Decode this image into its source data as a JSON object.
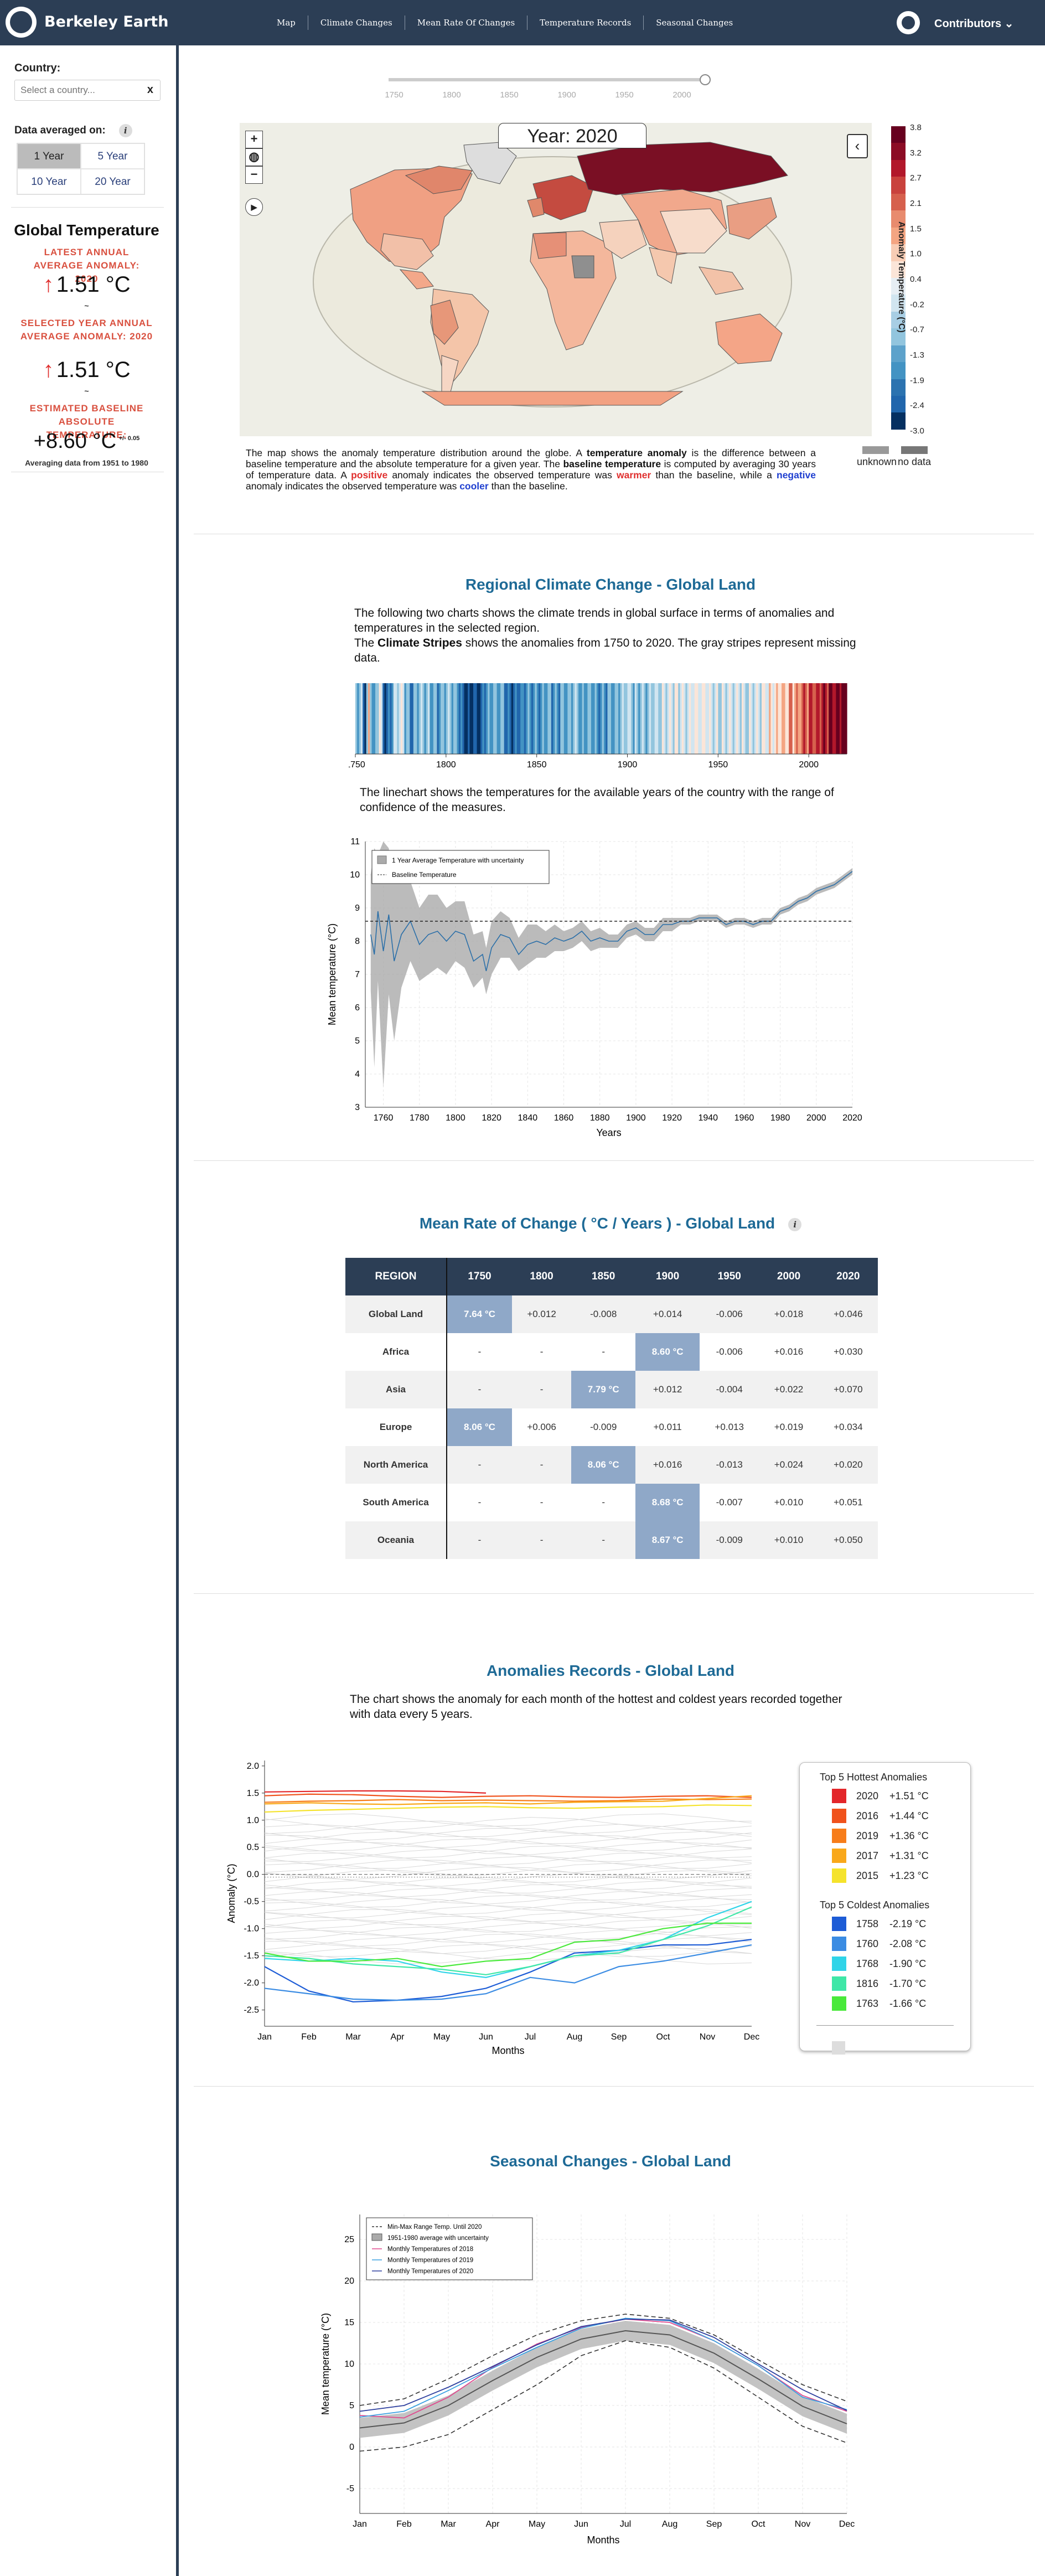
{
  "header": {
    "brand": "Berkeley Earth",
    "nav": [
      "Map",
      "Climate Changes",
      "Mean Rate Of Changes",
      "Temperature Records",
      "Seasonal Changes"
    ],
    "contributors": "Contributors"
  },
  "sidebar": {
    "country_label": "Country:",
    "country_placeholder": "Select a country...",
    "clear": "x",
    "avg_label": "Data averaged on:",
    "avg_options": [
      "1 Year",
      "5 Year",
      "10 Year",
      "20 Year"
    ],
    "avg_selected": "1 Year",
    "global_title": "Global Temperature",
    "latest_label": "LATEST ANNUAL AVERAGE ANOMALY: 2020",
    "latest_value": "1.51 °C",
    "selected_label": "SELECTED YEAR ANNUAL AVERAGE ANOMALY: 2020",
    "selected_value": "1.51 °C",
    "dash": "~",
    "baseline_label": "ESTIMATED BASELINE ABSOLUTE TEMPERATURE:",
    "baseline_value": "+8.60 °C",
    "baseline_unc": "+/- 0.05",
    "baseline_note": "Averaging data from 1951 to 1980"
  },
  "map": {
    "slider_years": [
      "1750",
      "1800",
      "1850",
      "1900",
      "1950",
      "2000"
    ],
    "year_title": "Year: 2020",
    "legend_ticks": [
      "3.8",
      "3.2",
      "2.7",
      "2.1",
      "1.5",
      "1.0",
      "0.4",
      "-0.2",
      "-0.7",
      "-1.3",
      "-1.9",
      "-2.4",
      "-3.0"
    ],
    "legend_title": "Anomaly Temperature (°C)",
    "legend_colors": [
      "#67001f",
      "#8c0c25",
      "#b2182b",
      "#c9423d",
      "#d6604d",
      "#e88b6e",
      "#f4a582",
      "#f8cdb5",
      "#fbe5d8",
      "#e7eef4",
      "#d1e5f0",
      "#a8cee4",
      "#92c5de",
      "#5da2cb",
      "#4393c3",
      "#2c73b0",
      "#2166ac",
      "#053061"
    ],
    "unknown": "unknown",
    "nodata": "no data",
    "desc_html": "The map shows the anomaly temperature distribution around the globe. A <b>temperature anomaly</b> is the difference between a baseline temperature and the absolute temperature for a given year. The <b>baseline temperature</b> is computed by averaging 30 years of temperature data. A <b style=\"color:#e0302f\">positive</b> anomaly indicates the observed temperature was <b style=\"color:#e0302f\">warmer</b> than the baseline, while a <b style=\"color:#1f3fd0\">negative</b> anomaly indicates the observed temperature was <b style=\"color:#1f3fd0\">cooler</b> than the baseline."
  },
  "regional": {
    "title": "Regional Climate Change - Global Land",
    "para1": "The following two charts shows the climate trends in global surface in terms of anomalies and temperatures in the selected region.",
    "para2_b": "Climate Stripes",
    "para2_pre": "The ",
    "para2_post": " shows the anomalies from 1750 to 2020. The gray stripes represent missing data.",
    "stripe_ticks": [
      "1750",
      "1800",
      "1850",
      "1900",
      "1950",
      "2000"
    ],
    "para3": "The linechart shows the temperatures for the available years of the country with the range of confidence of the measures."
  },
  "chart_data": [
    {
      "type": "line",
      "title": "",
      "xlabel": "Years",
      "ylabel": "Mean temperature (°C)",
      "xlim": [
        1750,
        2020
      ],
      "ylim": [
        3,
        11
      ],
      "x_ticks": [
        1760,
        1780,
        1800,
        1820,
        1840,
        1860,
        1880,
        1900,
        1920,
        1940,
        1960,
        1980,
        2000,
        2020
      ],
      "y_ticks": [
        3,
        4,
        5,
        6,
        7,
        8,
        9,
        10,
        11
      ],
      "legend": [
        "1 Year Average Temperature with uncertainty",
        "Baseline Temperature"
      ],
      "baseline": 8.6,
      "series": [
        {
          "name": "1 Year Average Temperature with uncertainty",
          "x": [
            1753,
            1755,
            1757,
            1760,
            1763,
            1766,
            1770,
            1775,
            1780,
            1785,
            1790,
            1795,
            1800,
            1805,
            1810,
            1815,
            1817,
            1820,
            1825,
            1830,
            1835,
            1840,
            1845,
            1850,
            1855,
            1860,
            1865,
            1870,
            1875,
            1880,
            1885,
            1890,
            1895,
            1900,
            1905,
            1910,
            1915,
            1920,
            1925,
            1930,
            1935,
            1940,
            1945,
            1950,
            1955,
            1960,
            1965,
            1970,
            1975,
            1980,
            1985,
            1990,
            1995,
            2000,
            2005,
            2010,
            2015,
            2020
          ],
          "y": [
            8.2,
            7.6,
            8.9,
            7.7,
            8.8,
            7.4,
            8.2,
            8.6,
            7.9,
            8.2,
            8.3,
            8.0,
            8.3,
            8.2,
            7.4,
            7.6,
            7.1,
            7.8,
            8.2,
            8.1,
            7.6,
            7.9,
            8.0,
            7.9,
            8.1,
            8.0,
            8.1,
            8.3,
            8.0,
            8.1,
            8.0,
            8.0,
            8.3,
            8.4,
            8.2,
            8.2,
            8.5,
            8.5,
            8.6,
            8.6,
            8.7,
            8.7,
            8.7,
            8.5,
            8.6,
            8.6,
            8.5,
            8.6,
            8.6,
            8.9,
            9.0,
            9.2,
            9.3,
            9.5,
            9.6,
            9.7,
            9.9,
            10.1
          ],
          "lo": [
            6.5,
            4.2,
            6.8,
            3.6,
            6.4,
            5.0,
            6.6,
            7.4,
            6.8,
            7.0,
            7.2,
            7.0,
            7.4,
            7.2,
            6.6,
            6.9,
            6.4,
            7.0,
            7.5,
            7.5,
            7.1,
            7.3,
            7.5,
            7.5,
            7.7,
            7.7,
            7.8,
            8.0,
            7.7,
            7.8,
            7.8,
            7.8,
            8.1,
            8.2,
            8.0,
            8.0,
            8.3,
            8.3,
            8.5,
            8.5,
            8.6,
            8.6,
            8.6,
            8.4,
            8.5,
            8.5,
            8.4,
            8.5,
            8.5,
            8.8,
            8.9,
            9.1,
            9.2,
            9.4,
            9.5,
            9.6,
            9.8,
            10.0
          ],
          "hi": [
            10.0,
            10.8,
            10.6,
            11.0,
            10.8,
            9.8,
            9.8,
            9.8,
            9.0,
            9.4,
            9.4,
            9.0,
            9.2,
            9.2,
            8.2,
            8.3,
            7.8,
            8.6,
            8.9,
            8.7,
            8.1,
            8.5,
            8.5,
            8.3,
            8.5,
            8.3,
            8.4,
            8.6,
            8.3,
            8.4,
            8.2,
            8.2,
            8.5,
            8.6,
            8.4,
            8.4,
            8.7,
            8.7,
            8.7,
            8.7,
            8.8,
            8.8,
            8.8,
            8.6,
            8.7,
            8.7,
            8.6,
            8.7,
            8.7,
            9.0,
            9.1,
            9.3,
            9.4,
            9.6,
            9.7,
            9.8,
            10.0,
            10.2
          ]
        }
      ]
    },
    {
      "type": "line",
      "title": "",
      "xlabel": "Months",
      "ylabel": "Anomaly (°C)",
      "categories": [
        "Jan",
        "Feb",
        "Mar",
        "Apr",
        "May",
        "Jun",
        "Jul",
        "Aug",
        "Sep",
        "Oct",
        "Nov",
        "Dec"
      ],
      "ylim": [
        -2.8,
        2.1
      ],
      "y_ticks": [
        -2.5,
        -2.0,
        -1.5,
        -1.0,
        -0.5,
        0.0,
        0.5,
        1.0,
        1.5,
        2.0
      ],
      "legend_title_hot": "Top 5 Hottest Anomalies",
      "legend_title_cold": "Top 5 Coldest Anomalies",
      "series": [
        {
          "name": "2020",
          "label": "+1.51 °C",
          "color": "#e3262a",
          "values": [
            1.52,
            1.53,
            1.54,
            1.54,
            1.53,
            1.5
          ]
        },
        {
          "name": "2016",
          "label": "+1.44 °C",
          "color": "#f0521c",
          "values": [
            1.45,
            1.48,
            1.47,
            1.44,
            1.42,
            1.44,
            1.45,
            1.43,
            1.42,
            1.44,
            1.45,
            1.42
          ]
        },
        {
          "name": "2019",
          "label": "+1.36 °C",
          "color": "#f77d1a",
          "values": [
            1.33,
            1.35,
            1.36,
            1.38,
            1.36,
            1.37,
            1.36,
            1.35,
            1.36,
            1.39,
            1.38,
            1.39
          ]
        },
        {
          "name": "2017",
          "label": "+1.31 °C",
          "color": "#f9a81a",
          "values": [
            1.3,
            1.32,
            1.3,
            1.29,
            1.31,
            1.32,
            1.3,
            1.33,
            1.34,
            1.35,
            1.4,
            1.45
          ]
        },
        {
          "name": "2015",
          "label": "+1.23 °C",
          "color": "#f5e32c",
          "values": [
            1.15,
            1.18,
            1.2,
            1.22,
            1.24,
            1.25,
            1.23,
            1.22,
            1.24,
            1.25,
            1.28,
            1.27
          ]
        },
        {
          "name": "1758",
          "label": "-2.19 °C",
          "color": "#1d5cd6",
          "values": [
            -1.7,
            -2.15,
            -2.35,
            -2.32,
            -2.25,
            -2.1,
            -1.8,
            -1.45,
            -1.4,
            -1.3,
            -1.3,
            -1.2
          ]
        },
        {
          "name": "1760",
          "label": "-2.08 °C",
          "color": "#3b8ce3",
          "values": [
            -2.1,
            -2.2,
            -2.3,
            -2.32,
            -2.3,
            -2.2,
            -1.9,
            -2.0,
            -1.7,
            -1.6,
            -1.45,
            -1.3
          ]
        },
        {
          "name": "1768",
          "label": "-1.90 °C",
          "color": "#2fd4e8",
          "values": [
            -1.55,
            -1.6,
            -1.55,
            -1.6,
            -1.8,
            -1.9,
            -1.7,
            -1.5,
            -1.4,
            -1.2,
            -0.8,
            -0.5
          ]
        },
        {
          "name": "1816",
          "label": "-1.70 °C",
          "color": "#3fe7a7",
          "values": [
            -1.5,
            -1.55,
            -1.65,
            -1.7,
            -1.75,
            -1.85,
            -1.7,
            -1.5,
            -1.45,
            -1.2,
            -0.95,
            -0.6
          ]
        },
        {
          "name": "1763",
          "label": "-1.66 °C",
          "color": "#49e93a",
          "values": [
            -1.45,
            -1.6,
            -1.6,
            -1.55,
            -1.7,
            -1.6,
            -1.55,
            -1.25,
            -1.2,
            -1.0,
            -0.9,
            -0.9
          ]
        }
      ]
    },
    {
      "type": "line",
      "title": "",
      "xlabel": "Months",
      "ylabel": "Mean temperature (°C)",
      "categories": [
        "Jan",
        "Feb",
        "Mar",
        "Apr",
        "May",
        "Jun",
        "Jul",
        "Aug",
        "Sep",
        "Oct",
        "Nov",
        "Dec"
      ],
      "ylim": [
        -8,
        28
      ],
      "y_ticks": [
        -5,
        0,
        5,
        10,
        15,
        20,
        25
      ],
      "legend": [
        "Min-Max Range Temp. Until 2020",
        "1951-1980 average with uncertainty",
        "Monthly Temperatures of 2018",
        "Monthly Temperatures of 2019",
        "Monthly Temperatures of 2020"
      ],
      "series": [
        {
          "name": "Min-Max Range Temp. Until 2020 (max)",
          "values": [
            5.0,
            5.8,
            8.2,
            11.0,
            13.5,
            15.2,
            16.0,
            15.5,
            13.5,
            10.5,
            7.5,
            5.5
          ]
        },
        {
          "name": "Min-Max Range Temp. Until 2020 (min)",
          "values": [
            -0.5,
            0.0,
            1.5,
            4.5,
            7.5,
            11.0,
            12.8,
            12.0,
            9.5,
            6.0,
            2.5,
            0.5
          ]
        },
        {
          "name": "1951-1980 average",
          "values": [
            2.3,
            2.9,
            5.0,
            8.0,
            10.8,
            13.0,
            14.0,
            13.5,
            11.3,
            8.2,
            4.9,
            2.8
          ]
        },
        {
          "name": "Monthly Temperatures of 2018",
          "values": [
            3.8,
            3.5,
            6.0,
            9.6,
            12.4,
            14.4,
            15.4,
            15.0,
            12.8,
            9.8,
            6.2,
            4.3
          ]
        },
        {
          "name": "Monthly Temperatures of 2019",
          "values": [
            3.6,
            4.3,
            6.8,
            9.5,
            12.0,
            14.3,
            15.5,
            15.2,
            12.8,
            9.8,
            6.0,
            4.5
          ]
        },
        {
          "name": "Monthly Temperatures of 2020",
          "values": [
            4.3,
            5.0,
            7.2,
            9.7,
            12.3,
            14.5,
            15.4,
            15.3,
            13.2,
            10.0,
            6.9,
            4.4
          ]
        }
      ]
    }
  ],
  "rate": {
    "title": "Mean Rate of Change ( °C / Years ) - Global Land",
    "headers": [
      "REGION",
      "1750",
      "1800",
      "1850",
      "1900",
      "1950",
      "2000",
      "2020"
    ],
    "rows": [
      [
        "Global Land",
        "7.64 °C",
        "+0.012",
        "-0.008",
        "+0.014",
        "-0.006",
        "+0.018",
        "+0.046"
      ],
      [
        "Africa",
        "-",
        "-",
        "-",
        "8.60 °C",
        "-0.006",
        "+0.016",
        "+0.030"
      ],
      [
        "Asia",
        "-",
        "-",
        "7.79 °C",
        "+0.012",
        "-0.004",
        "+0.022",
        "+0.070"
      ],
      [
        "Europe",
        "8.06 °C",
        "+0.006",
        "-0.009",
        "+0.011",
        "+0.013",
        "+0.019",
        "+0.034"
      ],
      [
        "North America",
        "-",
        "-",
        "8.06 °C",
        "+0.016",
        "-0.013",
        "+0.024",
        "+0.020"
      ],
      [
        "South America",
        "-",
        "-",
        "-",
        "8.68 °C",
        "-0.007",
        "+0.010",
        "+0.051"
      ],
      [
        "Oceania",
        "-",
        "-",
        "-",
        "8.67 °C",
        "-0.009",
        "+0.010",
        "+0.050"
      ]
    ]
  },
  "records": {
    "title": "Anomalies Records - Global Land",
    "para": "The chart shows the anomaly for each month of the hottest and coldest years recorded together with data every 5 years."
  },
  "seasonal": {
    "title": "Seasonal Changes - Global Land"
  }
}
